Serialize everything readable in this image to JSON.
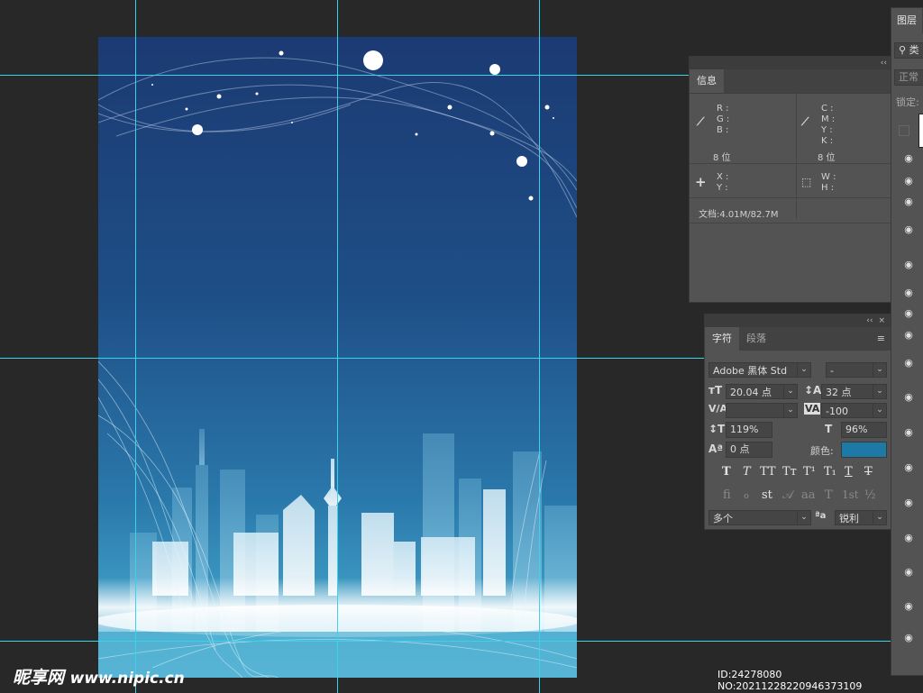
{
  "info_panel": {
    "tab": "信息",
    "collapse": "‹‹",
    "rgb_labels": [
      "R :",
      "G :",
      "B :"
    ],
    "cmyk_labels": [
      "C :",
      "M :",
      "Y :",
      "K :"
    ],
    "bit_left": "8 位",
    "bit_right": "8 位",
    "xy_labels": [
      "X :",
      "Y :"
    ],
    "wh_labels": [
      "W :",
      "H :"
    ],
    "doc": "文档:4.01M/82.7M"
  },
  "character_panel": {
    "tabs": [
      "字符",
      "段落"
    ],
    "collapse": "‹‹",
    "close": "×",
    "menu": "≡",
    "font_family": "Adobe 黑体 Std",
    "font_style": "-",
    "font_size": "20.04 点",
    "leading": "32 点",
    "kerning": "",
    "tracking": "-100",
    "vertical_scale": "119%",
    "horizontal_scale": "96%",
    "baseline_shift": "0 点",
    "color_label": "颜色:",
    "color_value": "#1d7aa6",
    "language": "多个",
    "antialias": "锐利",
    "style_buttons": [
      "T",
      "T",
      "TT",
      "Tт",
      "T¹",
      "T₁",
      "T",
      "T"
    ],
    "opentype_buttons": [
      "fi",
      "ℴ",
      "st",
      "𝒜",
      "aa",
      "T",
      "1st",
      "½"
    ]
  },
  "layers_panel": {
    "tab": "图层",
    "search": "类",
    "blend_mode": "正常",
    "lock_label": "锁定:"
  },
  "watermark": {
    "logo": "昵享网",
    "url": "www.nipic.cn",
    "id": "ID:24278080 NO:20211228220946373109"
  }
}
